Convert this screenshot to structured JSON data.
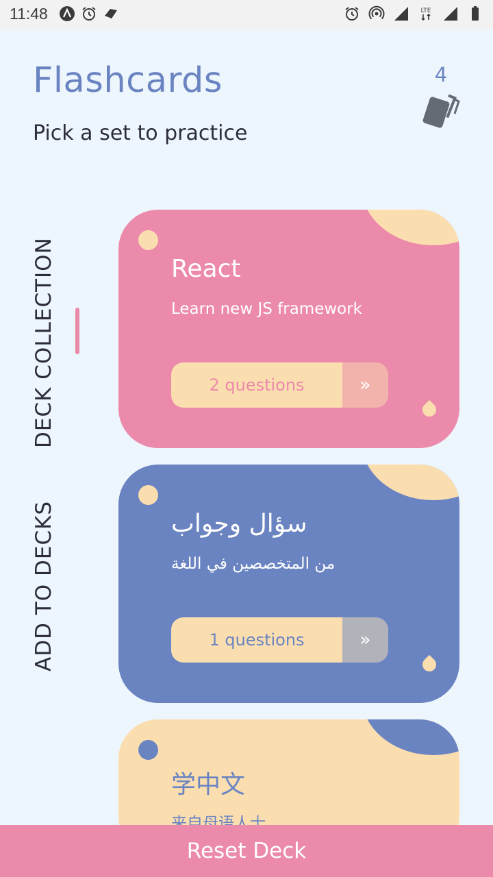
{
  "status_bar": {
    "time": "11:48",
    "left_icons": [
      "app-notification-icon",
      "alarm-icon",
      "tag-icon"
    ],
    "right_icons": [
      "alarm-icon",
      "hotspot-icon",
      "signal-icon",
      "lte-icon",
      "signal-icon-2",
      "battery-icon"
    ],
    "lte_label": "LTE"
  },
  "header": {
    "title": "Flashcards",
    "subtitle": "Pick a set to practice",
    "deck_count": "4",
    "deck_icon": "cards-stack-icon"
  },
  "nav": {
    "items": [
      {
        "label": "DECK COLLECTION",
        "active": true
      },
      {
        "label": "ADD TO DECKS",
        "active": false
      }
    ]
  },
  "decks": [
    {
      "title": "React",
      "description": "Learn new JS framework",
      "questions_label": "2 questions",
      "arrow": "»",
      "colors": {
        "card": "#ec8aab",
        "accent": "#fbdeb0",
        "label_text": "#ec8aab",
        "arrow_bg": "#f2b3ac"
      }
    },
    {
      "title": "سؤال وجواب",
      "description": "من المتخصصين في اللغة",
      "questions_label": "1 questions",
      "arrow": "»",
      "colors": {
        "card": "#6a84c2",
        "accent": "#fbdeb0",
        "label_text": "#6a84c2",
        "arrow_bg": "#b2b2bb"
      }
    },
    {
      "title": "学中文",
      "description": "来自母语人士",
      "colors": {
        "card": "#fbdeb0",
        "accent": "#6a84c2",
        "text": "#6a84c2"
      }
    }
  ],
  "footer": {
    "reset_label": "Reset Deck"
  },
  "colors": {
    "background": "#eef6fd",
    "primary": "#6a84c2",
    "pink": "#ec8aab",
    "cream": "#fbdeb0"
  }
}
